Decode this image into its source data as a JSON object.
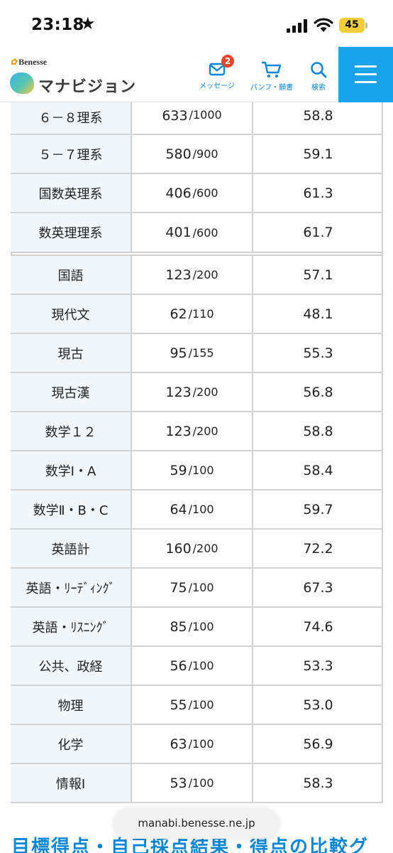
{
  "status_bar": {
    "time": "23:18",
    "battery": "45"
  },
  "header": {
    "brand_small": "Benesse",
    "brand": "マナビジョン",
    "message_label": "メッセージ",
    "message_badge": "2",
    "pamphlet_label": "パンフ・願書",
    "search_label": "検索"
  },
  "table": {
    "rows": [
      {
        "name": "６－８理系",
        "score": "633",
        "max": "/1000",
        "deviation": "58.8"
      },
      {
        "name": "５－７理系",
        "score": "580",
        "max": "/900",
        "deviation": "59.1"
      },
      {
        "name": "国数英理系",
        "score": "406",
        "max": "/600",
        "deviation": "61.3"
      },
      {
        "name": "数英理理系",
        "score": "401",
        "max": "/600",
        "deviation": "61.7"
      },
      {
        "name": "国語",
        "score": "123",
        "max": "/200",
        "deviation": "57.1"
      },
      {
        "name": "現代文",
        "score": "62",
        "max": "/110",
        "deviation": "48.1"
      },
      {
        "name": "現古",
        "score": "95",
        "max": "/155",
        "deviation": "55.3"
      },
      {
        "name": "現古漢",
        "score": "123",
        "max": "/200",
        "deviation": "56.8"
      },
      {
        "name": "数学１２",
        "score": "123",
        "max": "/200",
        "deviation": "58.8"
      },
      {
        "name": "数学Ⅰ・A",
        "score": "59",
        "max": "/100",
        "deviation": "58.4"
      },
      {
        "name": "数学Ⅱ・B・C",
        "score": "64",
        "max": "/100",
        "deviation": "59.7"
      },
      {
        "name": "英語計",
        "score": "160",
        "max": "/200",
        "deviation": "72.2"
      },
      {
        "name": "英語・ﾘｰﾃﾞｨﾝｸﾞ",
        "score": "75",
        "max": "/100",
        "deviation": "67.3"
      },
      {
        "name": "英語・ﾘｽﾆﾝｸﾞ",
        "score": "85",
        "max": "/100",
        "deviation": "74.6"
      },
      {
        "name": "公共、政経",
        "score": "56",
        "max": "/100",
        "deviation": "53.3"
      },
      {
        "name": "物理",
        "score": "55",
        "max": "/100",
        "deviation": "53.0"
      },
      {
        "name": "化学",
        "score": "63",
        "max": "/100",
        "deviation": "56.9"
      },
      {
        "name": "情報Ⅰ",
        "score": "53",
        "max": "/100",
        "deviation": "58.3"
      }
    ]
  },
  "footer": {
    "url": "manabi.benesse.ne.jp",
    "heading": "目標得点・自己採点結果・得点の比較グ"
  }
}
